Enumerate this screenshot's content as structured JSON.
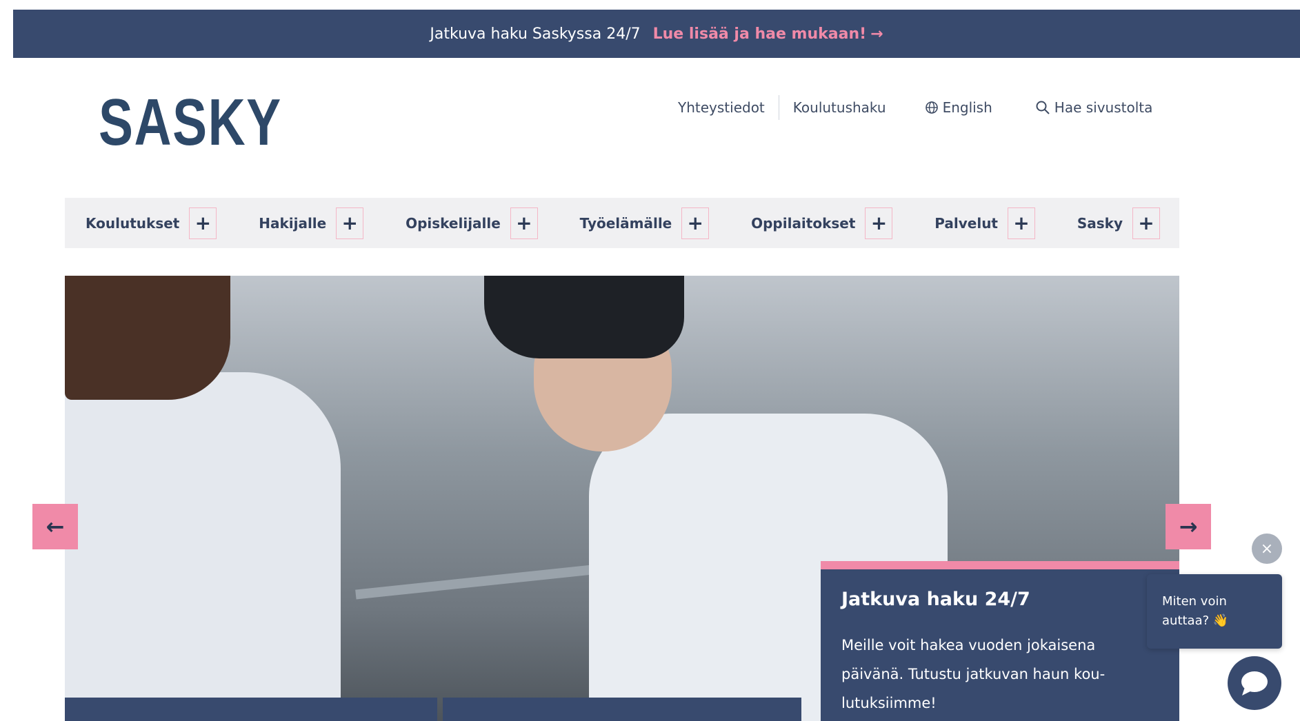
{
  "topbar": {
    "text": "Jatkuva haku Saskyssa 24/7",
    "link_label": "Lue lisää ja hae mukaan!",
    "link_arrow": "→"
  },
  "logo": {
    "text": "SASKY"
  },
  "utility_nav": {
    "contact": "Yhteystiedot",
    "course_search": "Koulutushaku",
    "language": "English",
    "site_search": "Hae sivustolta"
  },
  "main_nav": [
    {
      "label": "Koulutukset"
    },
    {
      "label": "Hakijalle"
    },
    {
      "label": "Opiskelijalle"
    },
    {
      "label": "Työelämälle"
    },
    {
      "label": "Oppilaitokset"
    },
    {
      "label": "Palvelut"
    },
    {
      "label": "Sasky"
    }
  ],
  "nav_expand_symbol": "+",
  "hero": {
    "prev_arrow": "←",
    "next_arrow": "→"
  },
  "promo_card": {
    "title": "Jatkuva haku 24/7",
    "body": "Meille voit hakea vuoden jokaisena päivänä. Tutustu jatkuvan haun kou-lutuksiimme!"
  },
  "chat": {
    "bubble_text": "Miten voin auttaa? 👋",
    "close_symbol": "×"
  },
  "colors": {
    "navy": "#384a6e",
    "pink": "#f08aa8",
    "nav_bg": "#f0f0f2",
    "logo": "#2d4868"
  },
  "icons": [
    "arrow-right-icon",
    "globe-icon",
    "search-icon",
    "plus-icon",
    "arrow-left-icon",
    "close-icon",
    "chat-icon"
  ]
}
